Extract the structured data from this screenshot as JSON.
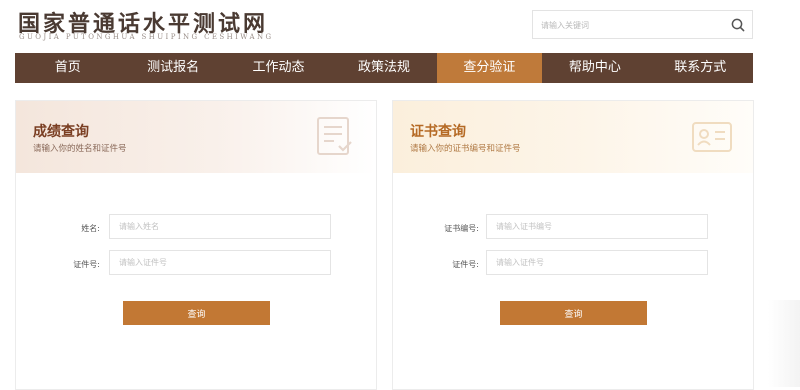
{
  "header": {
    "title": "国家普通话水平测试网",
    "subtitle": "GUOJIA PUTONGHUA SHUIPING CESHIWANG",
    "search_placeholder": "请输入关键词",
    "search_icon": "search-icon"
  },
  "nav": {
    "items": [
      {
        "label": "首页"
      },
      {
        "label": "测试报名"
      },
      {
        "label": "工作动态"
      },
      {
        "label": "政策法规"
      },
      {
        "label": "查分验证",
        "active": true
      },
      {
        "label": "帮助中心"
      },
      {
        "label": "联系方式"
      }
    ],
    "bg_color": "#5f4132",
    "active_color": "#bf7a3a"
  },
  "score_query": {
    "title": "成绩查询",
    "description": "请输入你的姓名和证件号",
    "icon": "document-check-icon",
    "name_label": "姓名:",
    "name_placeholder": "请输入姓名",
    "id_label": "证件号:",
    "id_placeholder": "请输入证件号",
    "button_label": "查询"
  },
  "certificate_query": {
    "title": "证书查询",
    "description": "请输入你的证书编号和证件号",
    "icon": "id-card-icon",
    "cert_label": "证书编号:",
    "cert_placeholder": "请输入证书编号",
    "id_label": "证件号:",
    "id_placeholder": "请输入证件号",
    "button_label": "查询"
  },
  "colors": {
    "brand_brown": "#5f4132",
    "accent_orange": "#c27834"
  }
}
